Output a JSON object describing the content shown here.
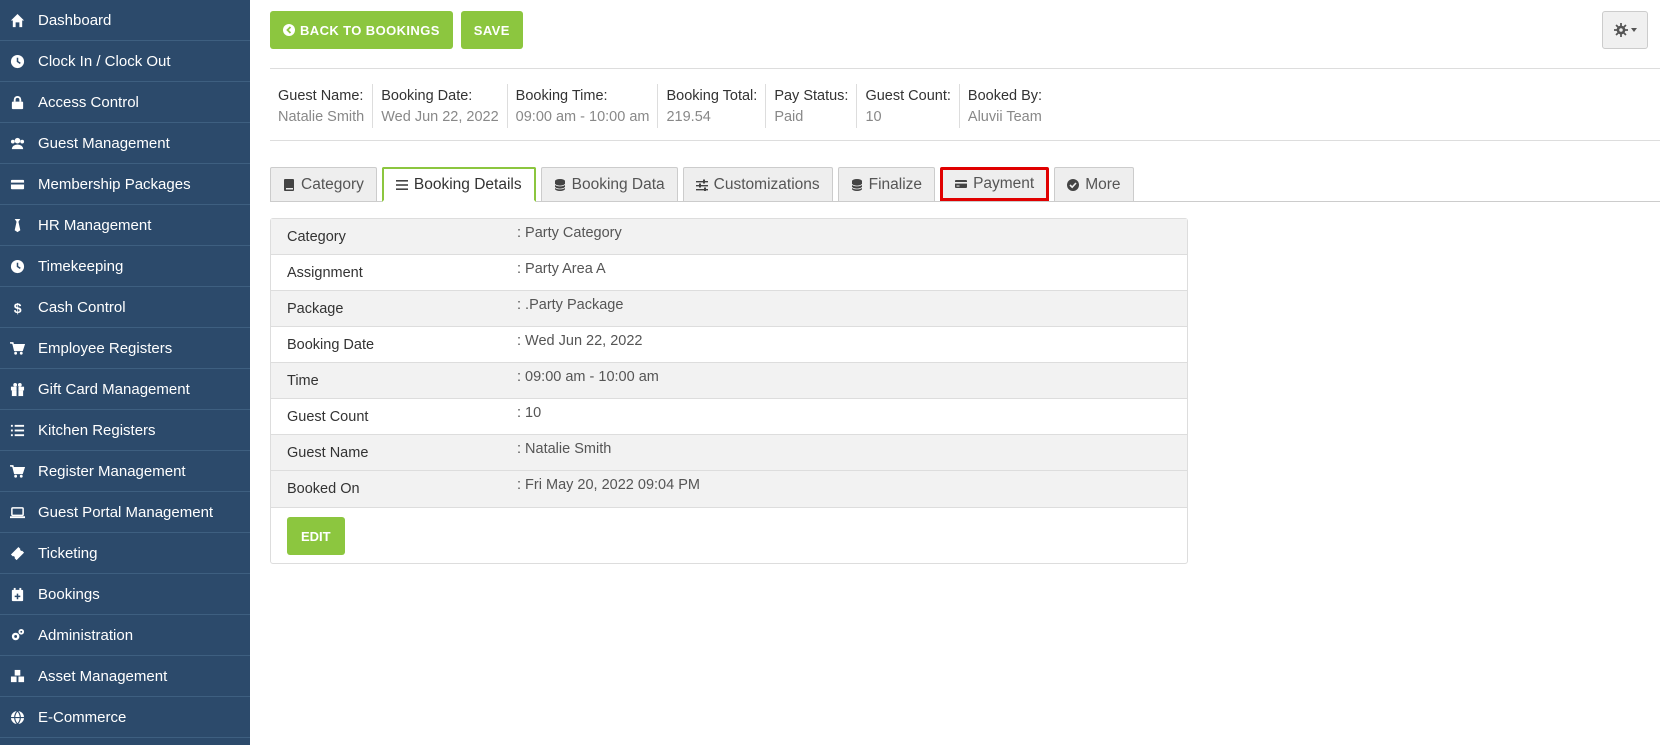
{
  "sidebar": {
    "items": [
      {
        "label": "Dashboard",
        "icon": "home-icon"
      },
      {
        "label": "Clock In / Clock Out",
        "icon": "clock-icon"
      },
      {
        "label": "Access Control",
        "icon": "lock-icon"
      },
      {
        "label": "Guest Management",
        "icon": "users-icon"
      },
      {
        "label": "Membership Packages",
        "icon": "card-icon"
      },
      {
        "label": "HR Management",
        "icon": "tie-icon"
      },
      {
        "label": "Timekeeping",
        "icon": "clock-icon"
      },
      {
        "label": "Cash Control",
        "icon": "dollar-icon"
      },
      {
        "label": "Employee Registers",
        "icon": "cart-icon"
      },
      {
        "label": "Gift Card Management",
        "icon": "gift-icon"
      },
      {
        "label": "Kitchen Registers",
        "icon": "list-icon"
      },
      {
        "label": "Register Management",
        "icon": "cart-plus-icon"
      },
      {
        "label": "Guest Portal Management",
        "icon": "laptop-icon"
      },
      {
        "label": "Ticketing",
        "icon": "ticket-icon"
      },
      {
        "label": "Bookings",
        "icon": "calendar-plus-icon"
      },
      {
        "label": "Administration",
        "icon": "cogs-icon"
      },
      {
        "label": "Asset Management",
        "icon": "cubes-icon"
      },
      {
        "label": "E-Commerce",
        "icon": "globe-icon"
      }
    ]
  },
  "toolbar": {
    "back_label": "BACK TO BOOKINGS",
    "save_label": "SAVE"
  },
  "summary": [
    {
      "label": "Guest Name:",
      "value": "Natalie Smith"
    },
    {
      "label": "Booking Date:",
      "value": "Wed Jun 22, 2022"
    },
    {
      "label": "Booking Time:",
      "value": "09:00 am - 10:00 am"
    },
    {
      "label": "Booking Total:",
      "value": "219.54"
    },
    {
      "label": "Pay Status:",
      "value": "Paid"
    },
    {
      "label": "Guest Count:",
      "value": "10"
    },
    {
      "label": "Booked By:",
      "value": "Aluvii Team"
    }
  ],
  "tabs": [
    {
      "label": "Category",
      "icon": "book-icon"
    },
    {
      "label": "Booking Details",
      "icon": "bars-icon"
    },
    {
      "label": "Booking Data",
      "icon": "database-icon"
    },
    {
      "label": "Customizations",
      "icon": "sliders-icon"
    },
    {
      "label": "Finalize",
      "icon": "database-icon"
    },
    {
      "label": "Payment",
      "icon": "credit-card-icon"
    },
    {
      "label": "More",
      "icon": "check-circle-icon"
    }
  ],
  "active_tab": "Booking Details",
  "highlighted_tab": "Payment",
  "details": [
    {
      "label": "Category",
      "value": ": Party Category"
    },
    {
      "label": "Assignment",
      "value": ": Party Area A"
    },
    {
      "label": "Package",
      "value": ": .Party Package"
    },
    {
      "label": "Booking Date",
      "value": ": Wed Jun 22, 2022"
    },
    {
      "label": "Time",
      "value": ": 09:00 am - 10:00 am"
    },
    {
      "label": "Guest Count",
      "value": ": 10"
    },
    {
      "label": "Guest Name",
      "value": ": Natalie Smith"
    },
    {
      "label": "Booked On",
      "value": ": Fri May 20, 2022 09:04 PM"
    }
  ],
  "edit_label": "EDIT",
  "colors": {
    "sidebar_bg": "#2c4a6b",
    "accent_green": "#8cc63f",
    "highlight_red": "#e00000"
  }
}
